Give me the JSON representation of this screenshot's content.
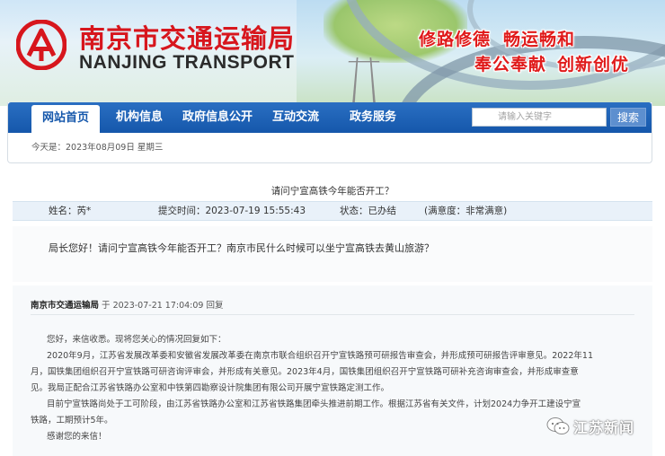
{
  "site": {
    "name_cn": "南京市交通运输局",
    "name_en": "NANJING TRANSPORT",
    "slogans": [
      "修路修德",
      "畅运畅和",
      "奉公奉献",
      "创新创优"
    ]
  },
  "nav": {
    "items": [
      {
        "label": "网站首页"
      },
      {
        "label": "机构信息"
      },
      {
        "label": "政府信息公开"
      },
      {
        "label": "互动交流"
      },
      {
        "label": "政务服务"
      }
    ],
    "search_placeholder": "请输入关键字",
    "search_button": "搜索"
  },
  "today": "今天是：2023年08月09日  星期三",
  "letter": {
    "title": "请问宁宣高铁今年能否开工？",
    "name": "姓名：芮*",
    "submit_time": "提交时间：2023-07-19 15:55:43",
    "status": "状态：已办结",
    "satisfaction": "(满意度：非常满意)",
    "question": "局长您好！请问宁宣高铁今年能否开工？南京市民什么时候可以坐宁宣高铁去黄山旅游？"
  },
  "reply": {
    "department": "南京市交通运输局",
    "meta": "于 2023-07-21 17:04:09 回复",
    "lines": [
      "您好，来信收悉。现将您关心的情况回复如下：",
      "2020年9月，江苏省发展改革委和安徽省发展改革委在南京市联合组织召开宁宣铁路预可研报告审查会，并形成预可研报告评审意见。2022年11",
      "月，国铁集团组织召开宁宣铁路可研咨询评审会，并形成有关意见。2023年4月，国铁集团组织召开宁宣铁路可研补充咨询审查会，并形成审查意",
      "见。我局正配合江苏省铁路办公室和中铁第四勘察设计院集团有限公司开展宁宣铁路定测工作。",
      "目前宁宣铁路尚处于工可阶段，由江苏省铁路办公室和江苏省铁路集团牵头推进前期工作。根据江苏省有关文件，计划2024力争开工建设宁宣",
      "铁路，工期预计5年。",
      "感谢您的来信！"
    ]
  },
  "watermark": {
    "text": "江苏新闻"
  }
}
